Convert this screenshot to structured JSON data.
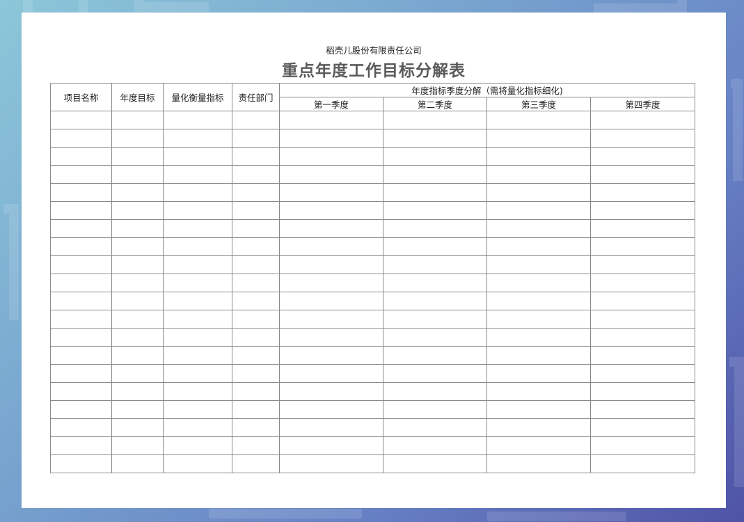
{
  "document": {
    "company": "稻壳儿股份有限责任公司",
    "title": "重点年度工作目标分解表"
  },
  "table": {
    "columns": [
      "项目名称",
      "年度目标",
      "量化衡量指标",
      "责任部门"
    ],
    "group_header": "年度指标季度分解（需将量化指标细化)",
    "quarters": [
      "第一季度",
      "第二季度",
      "第三季度",
      "第四季度"
    ],
    "empty_row_count": 20
  },
  "colors": {
    "background_start": "#8cc7d9",
    "background_end": "#4f53a6",
    "paper": "#ffffff",
    "title_text": "#5a5a5a",
    "grid_line": "#8a8a8a"
  }
}
